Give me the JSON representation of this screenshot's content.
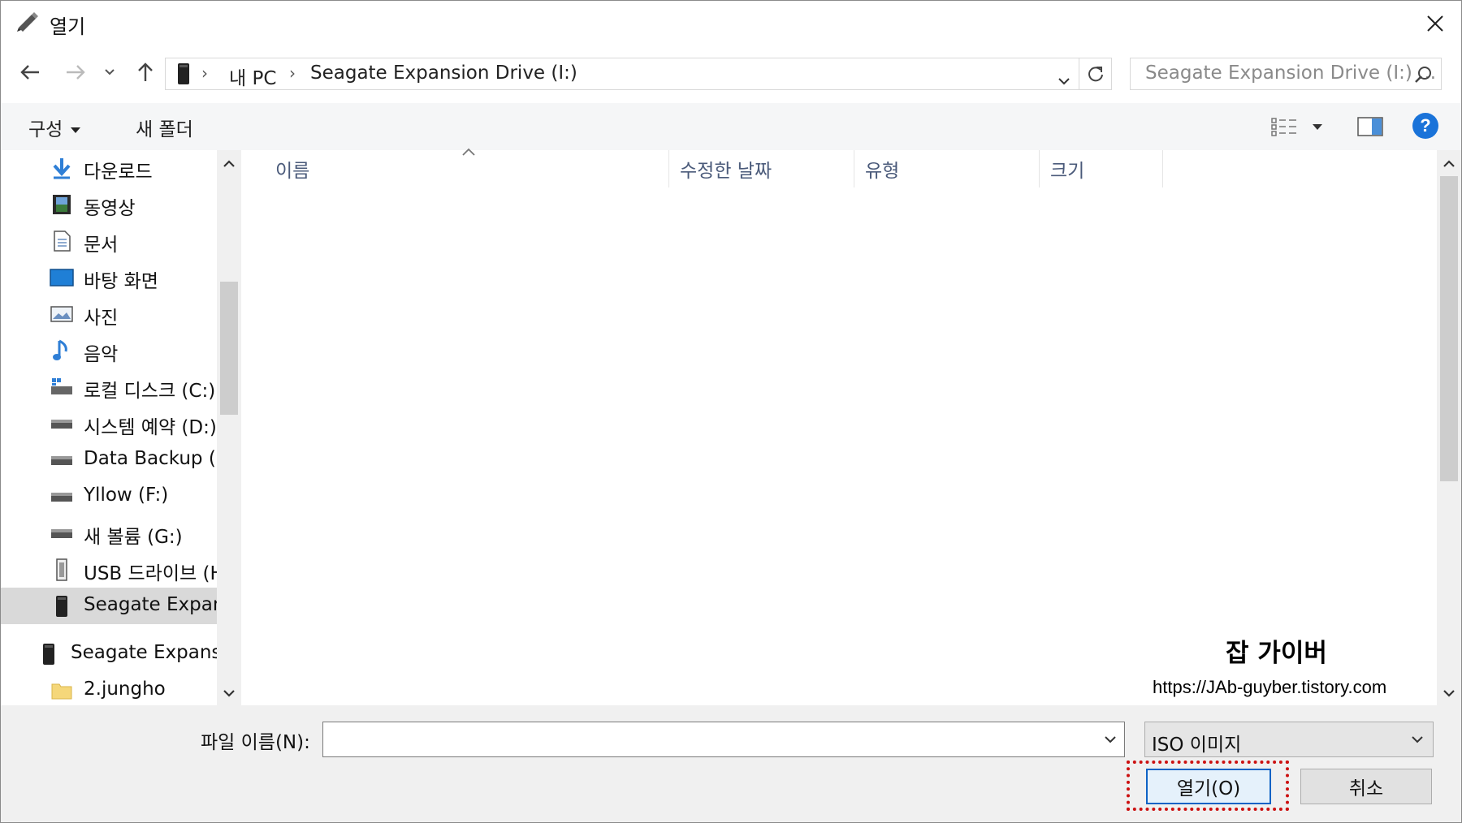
{
  "window": {
    "title": "열기",
    "close_icon": "close-icon"
  },
  "nav": {
    "back_icon": "back-arrow-icon",
    "forward_icon": "forward-arrow-icon",
    "recent_icon": "chevron-down-icon",
    "up_icon": "up-arrow-icon",
    "breadcrumb": [
      "내 PC",
      "Seagate Expansion Drive (I:)"
    ],
    "search_placeholder": "Seagate Expansion Drive (I:) ..."
  },
  "toolbar": {
    "organize_label": "구성",
    "new_folder_label": "새 폴더"
  },
  "sidebar": {
    "items": [
      {
        "label": "다운로드",
        "icon": "download-icon"
      },
      {
        "label": "동영상",
        "icon": "video-icon"
      },
      {
        "label": "문서",
        "icon": "document-icon"
      },
      {
        "label": "바탕 화면",
        "icon": "desktop-icon"
      },
      {
        "label": "사진",
        "icon": "picture-icon"
      },
      {
        "label": "음악",
        "icon": "music-icon"
      },
      {
        "label": "로컬 디스크 (C:)",
        "icon": "local-disk-icon"
      },
      {
        "label": "시스템 예약 (D:)",
        "icon": "drive-icon"
      },
      {
        "label": "Data Backup (E:)",
        "icon": "drive-icon"
      },
      {
        "label": "Yllow (F:)",
        "icon": "drive-icon"
      },
      {
        "label": "새 볼륨 (G:)",
        "icon": "drive-icon"
      },
      {
        "label": "USB 드라이브 (H:)",
        "icon": "usb-drive-icon"
      },
      {
        "label": "Seagate Expansion Drive (I:)",
        "icon": "external-drive-icon",
        "selected": true
      },
      {
        "label": "Seagate Expansion Drive (I:)",
        "icon": "external-drive-icon"
      },
      {
        "label": "2.jungho",
        "icon": "folder-icon"
      }
    ]
  },
  "filelist": {
    "columns": [
      "이름",
      "수정한 날짜",
      "유형",
      "크기"
    ]
  },
  "watermark": {
    "title": "잡 가이버",
    "url": "https://JAb-guyber.tistory.com"
  },
  "footer": {
    "filename_label": "파일 이름(N):",
    "filename_value": "",
    "filter_value": "ISO 이미지",
    "open_label": "열기(O)",
    "cancel_label": "취소"
  }
}
